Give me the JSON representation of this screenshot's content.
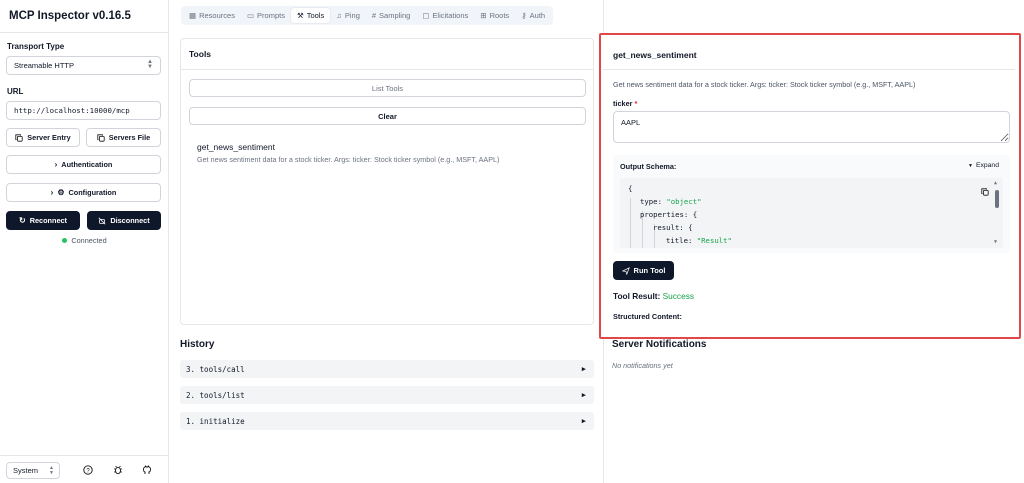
{
  "sidebar": {
    "title": "MCP Inspector v0.16.5",
    "transport_label": "Transport Type",
    "transport_value": "Streamable HTTP",
    "url_label": "URL",
    "url_value": "http://localhost:10000/mcp",
    "server_entry_label": "Server Entry",
    "servers_file_label": "Servers File",
    "authentication_label": "Authentication",
    "configuration_label": "Configuration",
    "reconnect_label": "Reconnect",
    "disconnect_label": "Disconnect",
    "status_text": "Connected",
    "status_color": "#22c55e",
    "theme_value": "System"
  },
  "tabs": [
    {
      "label": "Resources",
      "icon": "resources-icon"
    },
    {
      "label": "Prompts",
      "icon": "prompts-icon"
    },
    {
      "label": "Tools",
      "icon": "tools-icon",
      "active": true
    },
    {
      "label": "Ping",
      "icon": "bell-icon"
    },
    {
      "label": "Sampling",
      "icon": "hash-icon"
    },
    {
      "label": "Elicitations",
      "icon": "message-icon"
    },
    {
      "label": "Roots",
      "icon": "folder-tree-icon"
    },
    {
      "label": "Auth",
      "icon": "key-icon"
    }
  ],
  "tools": {
    "title": "Tools",
    "list_button": "List Tools",
    "clear_button": "Clear",
    "items": [
      {
        "name": "get_news_sentiment",
        "description": "Get news sentiment data for a stock ticker. Args: ticker: Stock ticker symbol (e.g., MSFT, AAPL)"
      }
    ]
  },
  "history": {
    "title": "History",
    "items": [
      "3. tools/call",
      "2. tools/list",
      "1. initialize"
    ]
  },
  "detail": {
    "title": "get_news_sentiment",
    "description": "Get news sentiment data for a stock ticker. Args: ticker: Stock ticker symbol (e.g., MSFT, AAPL)",
    "ticker_label": "ticker",
    "ticker_required": "*",
    "ticker_value": "AAPL",
    "schema_title": "Output Schema:",
    "expand_label": "Expand",
    "code": {
      "l1": "{",
      "l2_key": "type: ",
      "l2_val": "\"object\"",
      "l3": "properties: {",
      "l4": "result: {",
      "l5_key": "title: ",
      "l5_val": "\"Result\""
    },
    "run_button": "Run Tool",
    "result_label": "Tool Result:",
    "result_status": "Success",
    "result_color": "#16a34a",
    "structured_label": "Structured Content:"
  },
  "notifications": {
    "title": "Server Notifications",
    "empty_text": "No notifications yet"
  },
  "colors": {
    "highlight_border": "#e04848",
    "primary_button": "#0f172a"
  }
}
